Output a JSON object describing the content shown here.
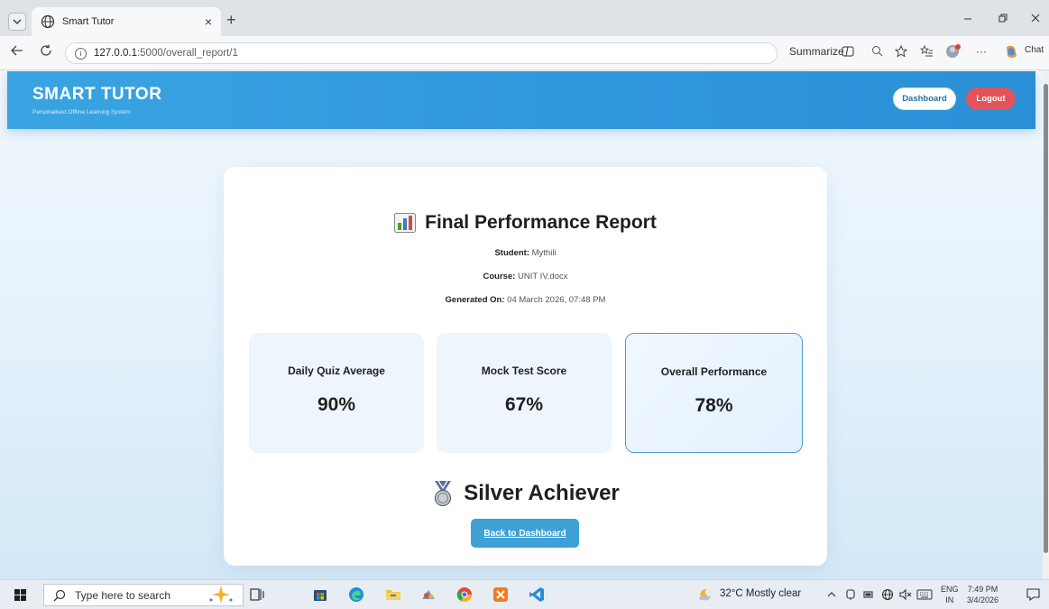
{
  "browser": {
    "tab_title": "Smart Tutor",
    "tab_close": "×",
    "new_tab": "+",
    "url_host": "127.0.0.1",
    "url_path": ":5000/overall_report/1",
    "summarize_label": "Summarize",
    "chat_label": "Chat",
    "more_label": "···"
  },
  "app": {
    "brand": "SMART TUTOR",
    "tagline": "Personalised Offline Learning System",
    "dashboard_btn": "Dashboard",
    "logout_btn": "Logout"
  },
  "report": {
    "title": "Final Performance Report",
    "student_label": "Student:",
    "student_value": "Mythili",
    "course_label": "Course:",
    "course_value": "UNIT IV.docx",
    "generated_label": "Generated On:",
    "generated_value": "04 March 2026, 07:48 PM",
    "stats": [
      {
        "label": "Daily Quiz Average",
        "value": "90%"
      },
      {
        "label": "Mock Test Score",
        "value": "67%"
      },
      {
        "label": "Overall Performance",
        "value": "78%"
      }
    ],
    "achievement": "Silver Achiever",
    "back_btn": "Back to Dashboard"
  },
  "taskbar": {
    "search_placeholder": "Type here to search",
    "weather": "32°C  Mostly clear",
    "lang_top": "ENG",
    "lang_bottom": "IN",
    "time": "7:49 PM",
    "date": "3/4/2026"
  },
  "colors": {
    "header": "#2f97dc",
    "logout": "#e0555b",
    "back_button": "#3ea0d6",
    "highlight_border": "#4f9ccc"
  }
}
